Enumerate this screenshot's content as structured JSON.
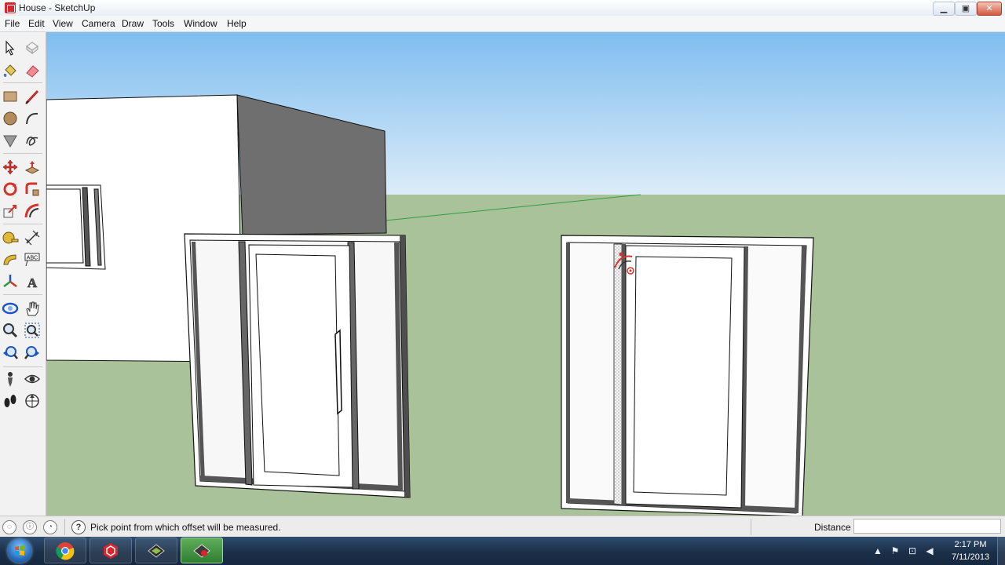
{
  "window": {
    "title": "House - SketchUp",
    "minimize_label": "▁",
    "maximize_label": "▣",
    "close_label": "✕"
  },
  "menu": {
    "items": [
      {
        "label": "File"
      },
      {
        "label": "Edit"
      },
      {
        "label": "View"
      },
      {
        "label": "Camera"
      },
      {
        "label": "Draw"
      },
      {
        "label": "Tools"
      },
      {
        "label": "Window"
      },
      {
        "label": "Help"
      }
    ]
  },
  "toolbar": {
    "tools": [
      {
        "name": "select-tool-icon",
        "label": ""
      },
      {
        "name": "make-component-tool-icon",
        "label": ""
      },
      {
        "name": "paint-bucket-tool-icon",
        "label": ""
      },
      {
        "name": "eraser-tool-icon",
        "label": ""
      },
      {
        "name": "rectangle-tool-icon",
        "label": ""
      },
      {
        "name": "line-tool-icon",
        "label": ""
      },
      {
        "name": "circle-tool-icon",
        "label": ""
      },
      {
        "name": "arc-tool-icon",
        "label": ""
      },
      {
        "name": "polygon-tool-icon",
        "label": ""
      },
      {
        "name": "freehand-tool-icon",
        "label": ""
      },
      {
        "name": "move-tool-icon",
        "label": ""
      },
      {
        "name": "push-pull-tool-icon",
        "label": ""
      },
      {
        "name": "rotate-tool-icon",
        "label": ""
      },
      {
        "name": "follow-me-tool-icon",
        "label": ""
      },
      {
        "name": "scale-tool-icon",
        "label": ""
      },
      {
        "name": "offset-tool-icon",
        "label": ""
      },
      {
        "name": "tape-measure-tool-icon",
        "label": ""
      },
      {
        "name": "dimension-tool-icon",
        "label": ""
      },
      {
        "name": "protractor-tool-icon",
        "label": ""
      },
      {
        "name": "text-tool-icon",
        "label": "ABC"
      },
      {
        "name": "axes-tool-icon",
        "label": ""
      },
      {
        "name": "3d-text-tool-icon",
        "label": "A"
      },
      {
        "name": "orbit-tool-icon",
        "label": ""
      },
      {
        "name": "pan-tool-icon",
        "label": ""
      },
      {
        "name": "zoom-tool-icon",
        "label": ""
      },
      {
        "name": "zoom-window-tool-icon",
        "label": ""
      },
      {
        "name": "previous-view-icon",
        "label": ""
      },
      {
        "name": "next-view-icon",
        "label": ""
      },
      {
        "name": "position-camera-tool-icon",
        "label": ""
      },
      {
        "name": "look-around-tool-icon",
        "label": ""
      },
      {
        "name": "walk-tool-icon",
        "label": ""
      },
      {
        "name": "section-plane-tool-icon",
        "label": ""
      }
    ]
  },
  "status": {
    "hint": "Pick point from which offset will be measured.",
    "help_label": "?",
    "vcb_label": "Distance",
    "vcb_value": ""
  },
  "taskbar": {
    "apps": [
      {
        "name": "chrome"
      },
      {
        "name": "sketchup"
      },
      {
        "name": "sketchup-layout"
      },
      {
        "name": "sketchup-style-builder"
      }
    ],
    "tray": {
      "time": "2:17 PM",
      "date": "7/11/2013"
    }
  },
  "colors": {
    "sky_top": "#7fbdf0",
    "sky_bottom": "#dcecf8",
    "ground": "#a9c29a",
    "shadow_face": "#6f6f6f",
    "axis_green": "#2ea043",
    "taskbar_active": "#3f8f3c"
  }
}
